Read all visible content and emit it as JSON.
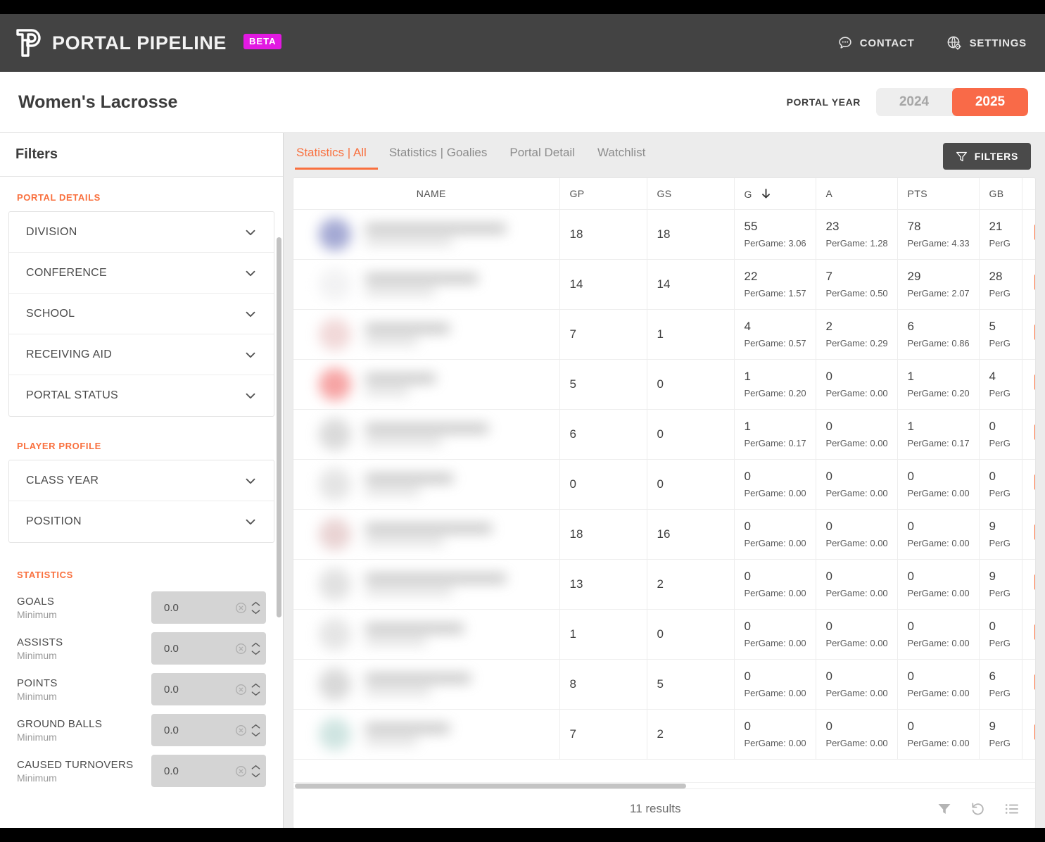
{
  "brand": {
    "name": "PORTAL PIPELINE",
    "badge": "BETA",
    "logo_icon": "pipeline-p-logo"
  },
  "topnav": [
    {
      "label": "CONTACT",
      "icon": "chat-bubble-icon"
    },
    {
      "label": "SETTINGS",
      "icon": "globe-gear-icon"
    }
  ],
  "header": {
    "title": "Women's Lacrosse",
    "portal_year_label": "PORTAL YEAR",
    "years": [
      {
        "label": "2024",
        "active": false
      },
      {
        "label": "2025",
        "active": true
      }
    ]
  },
  "colors": {
    "accent": "#f9703e",
    "accent_button": "#f96a48",
    "beta": "#e219e2",
    "topbar": "#434343"
  },
  "sidebar": {
    "title": "Filters",
    "sections": [
      {
        "title": "PORTAL DETAILS",
        "items": [
          {
            "label": "DIVISION"
          },
          {
            "label": "CONFERENCE"
          },
          {
            "label": "SCHOOL"
          },
          {
            "label": "RECEIVING AID"
          },
          {
            "label": "PORTAL STATUS"
          }
        ]
      },
      {
        "title": "PLAYER PROFILE",
        "items": [
          {
            "label": "CLASS YEAR"
          },
          {
            "label": "POSITION"
          }
        ]
      }
    ],
    "statistics": {
      "title": "STATISTICS",
      "sub_label": "Minimum",
      "fields": [
        {
          "label": "GOALS",
          "value": "0.0"
        },
        {
          "label": "ASSISTS",
          "value": "0.0"
        },
        {
          "label": "POINTS",
          "value": "0.0"
        },
        {
          "label": "GROUND BALLS",
          "value": "0.0"
        },
        {
          "label": "CAUSED TURNOVERS",
          "value": "0.0"
        }
      ]
    }
  },
  "main": {
    "tabs": [
      {
        "label": "Statistics | All",
        "active": true
      },
      {
        "label": "Statistics | Goalies",
        "active": false
      },
      {
        "label": "Portal Detail",
        "active": false
      },
      {
        "label": "Watchlist",
        "active": false
      }
    ],
    "filters_button": {
      "label": "FILTERS",
      "icon": "funnel-icon"
    },
    "table": {
      "columns": [
        {
          "key": "name",
          "label": "NAME",
          "sorted": false
        },
        {
          "key": "gp",
          "label": "GP",
          "sorted": false
        },
        {
          "key": "gs",
          "label": "GS",
          "sorted": false
        },
        {
          "key": "g",
          "label": "G",
          "sorted": true,
          "sort_dir": "desc"
        },
        {
          "key": "a",
          "label": "A",
          "sorted": false
        },
        {
          "key": "pts",
          "label": "PTS",
          "sorted": false
        },
        {
          "key": "gb",
          "label": "GB",
          "sorted": false
        },
        {
          "key": "mark",
          "label": "",
          "sorted": false
        }
      ],
      "per_game_prefix": "PerGame:",
      "rows": [
        {
          "name": "",
          "gp": "18",
          "gs": "18",
          "g": "55",
          "g_pg": "PerGame: 3.06",
          "a": "23",
          "a_pg": "PerGame: 1.28",
          "pts": "78",
          "pts_pg": "PerGame: 4.33",
          "gb": "21",
          "gb_pg": "PerG",
          "bookmark_icon": "bookmark-icon"
        },
        {
          "name": "",
          "gp": "14",
          "gs": "14",
          "g": "22",
          "g_pg": "PerGame: 1.57",
          "a": "7",
          "a_pg": "PerGame: 0.50",
          "pts": "29",
          "pts_pg": "PerGame: 2.07",
          "gb": "28",
          "gb_pg": "PerG",
          "bookmark_icon": "bookmark-icon"
        },
        {
          "name": "",
          "gp": "7",
          "gs": "1",
          "g": "4",
          "g_pg": "PerGame: 0.57",
          "a": "2",
          "a_pg": "PerGame: 0.29",
          "pts": "6",
          "pts_pg": "PerGame: 0.86",
          "gb": "5",
          "gb_pg": "PerG",
          "bookmark_icon": "bookmark-icon"
        },
        {
          "name": "",
          "gp": "5",
          "gs": "0",
          "g": "1",
          "g_pg": "PerGame: 0.20",
          "a": "0",
          "a_pg": "PerGame: 0.00",
          "pts": "1",
          "pts_pg": "PerGame: 0.20",
          "gb": "4",
          "gb_pg": "PerG",
          "bookmark_icon": "bookmark-icon"
        },
        {
          "name": "",
          "gp": "6",
          "gs": "0",
          "g": "1",
          "g_pg": "PerGame: 0.17",
          "a": "0",
          "a_pg": "PerGame: 0.00",
          "pts": "1",
          "pts_pg": "PerGame: 0.17",
          "gb": "0",
          "gb_pg": "PerG",
          "bookmark_icon": "bookmark-icon"
        },
        {
          "name": "",
          "gp": "0",
          "gs": "0",
          "g": "0",
          "g_pg": "PerGame: 0.00",
          "a": "0",
          "a_pg": "PerGame: 0.00",
          "pts": "0",
          "pts_pg": "PerGame: 0.00",
          "gb": "0",
          "gb_pg": "PerG",
          "bookmark_icon": "bookmark-icon"
        },
        {
          "name": "",
          "gp": "18",
          "gs": "16",
          "g": "0",
          "g_pg": "PerGame: 0.00",
          "a": "0",
          "a_pg": "PerGame: 0.00",
          "pts": "0",
          "pts_pg": "PerGame: 0.00",
          "gb": "9",
          "gb_pg": "PerG",
          "bookmark_icon": "bookmark-icon"
        },
        {
          "name": "",
          "gp": "13",
          "gs": "2",
          "g": "0",
          "g_pg": "PerGame: 0.00",
          "a": "0",
          "a_pg": "PerGame: 0.00",
          "pts": "0",
          "pts_pg": "PerGame: 0.00",
          "gb": "9",
          "gb_pg": "PerG",
          "bookmark_icon": "bookmark-icon"
        },
        {
          "name": "",
          "gp": "1",
          "gs": "0",
          "g": "0",
          "g_pg": "PerGame: 0.00",
          "a": "0",
          "a_pg": "PerGame: 0.00",
          "pts": "0",
          "pts_pg": "PerGame: 0.00",
          "gb": "0",
          "gb_pg": "PerG",
          "bookmark_icon": "bookmark-icon"
        },
        {
          "name": "",
          "gp": "8",
          "gs": "5",
          "g": "0",
          "g_pg": "PerGame: 0.00",
          "a": "0",
          "a_pg": "PerGame: 0.00",
          "pts": "0",
          "pts_pg": "PerGame: 0.00",
          "gb": "6",
          "gb_pg": "PerG",
          "bookmark_icon": "bookmark-icon"
        },
        {
          "name": "",
          "gp": "7",
          "gs": "2",
          "g": "0",
          "g_pg": "PerGame: 0.00",
          "a": "0",
          "a_pg": "PerGame: 0.00",
          "pts": "0",
          "pts_pg": "PerGame: 0.00",
          "gb": "9",
          "gb_pg": "PerG",
          "bookmark_icon": "bookmark-icon"
        }
      ],
      "footer": {
        "results_text": "11 results",
        "icons": [
          {
            "name": "filter-funnel-icon"
          },
          {
            "name": "reset-icon"
          },
          {
            "name": "columns-list-icon"
          }
        ]
      }
    }
  }
}
